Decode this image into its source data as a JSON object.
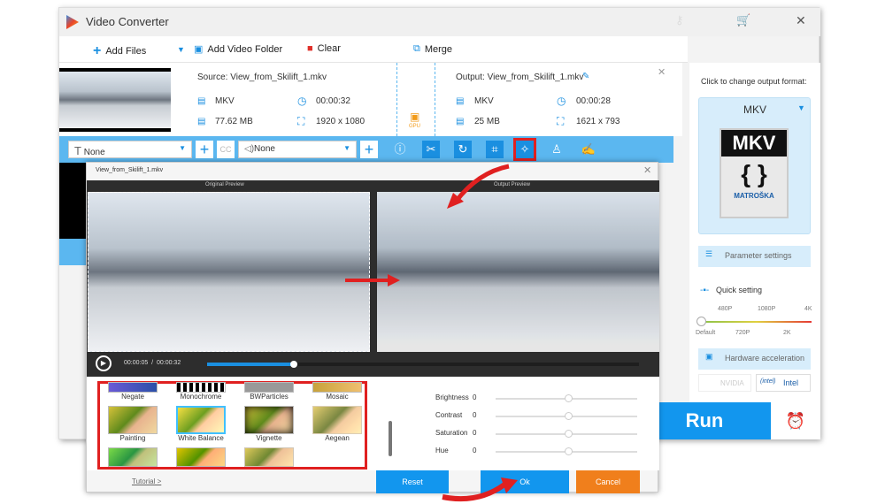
{
  "app": {
    "title": "Video Converter"
  },
  "toolbar": {
    "add_files": "Add Files",
    "add_folder": "Add Video Folder",
    "clear": "Clear",
    "merge": "Merge"
  },
  "file": {
    "source": "Source: View_from_Skilift_1.mkv",
    "src_format": "MKV",
    "src_duration": "00:00:32",
    "src_size": "77.62 MB",
    "src_resolution": "1920 x 1080",
    "gpu": "GPU",
    "output": "Output: View_from_Skilift_1.mkv",
    "out_format": "MKV",
    "out_duration": "00:00:28",
    "out_size": "25 MB",
    "out_resolution": "1621 x 793"
  },
  "editbar": {
    "subtitle": "None",
    "audio": "None",
    "cc": "CC"
  },
  "right": {
    "hint": "Click to change output format:",
    "format": "MKV",
    "logo_top": "MKV",
    "logo_bottom": "MATROŠKA",
    "param": "Parameter settings",
    "quick": "Quick setting",
    "q_top": [
      "480P",
      "1080P",
      "4K"
    ],
    "q_bottom": [
      "Default",
      "720P",
      "2K"
    ],
    "hw": "Hardware acceleration",
    "nvidia": "NVIDIA",
    "intel": "Intel",
    "run": "Run"
  },
  "dialog": {
    "title": "View_from_Skilift_1.mkv",
    "orig": "Original Preview",
    "out": "Output Preview",
    "time": "00:00:05  /  00:00:32",
    "progress": 0.2,
    "effects": [
      "Negate",
      "Monochrome",
      "BWParticles",
      "Mosaic",
      "Painting",
      "White Balance",
      "Vignette",
      "Aegean"
    ],
    "adjust": [
      {
        "label": "Brightness",
        "value": "0"
      },
      {
        "label": "Contrast",
        "value": "0"
      },
      {
        "label": "Saturation",
        "value": "0"
      },
      {
        "label": "Hue",
        "value": "0"
      }
    ],
    "tutorial": "Tutorial >",
    "reset": "Reset",
    "ok": "Ok",
    "cancel": "Cancel"
  },
  "colors": {
    "accent": "#1296ee",
    "cancel": "#f07f1c",
    "highlight": "#e02020"
  }
}
